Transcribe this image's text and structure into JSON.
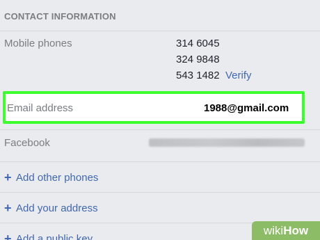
{
  "contact": {
    "section_title": "CONTACT INFORMATION",
    "mobile_label": "Mobile phones",
    "phones": [
      "314 6045",
      "324 9848",
      "543 1482"
    ],
    "verify_label": "Verify",
    "email_label": "Email address",
    "email_value": "1988@gmail.com",
    "facebook_label": "Facebook",
    "add_links": [
      "Add other phones",
      "Add your address",
      "Add a public key"
    ]
  },
  "icons": {
    "plus": "+"
  },
  "watermark": {
    "wiki": "wiki",
    "how": "How"
  },
  "colors": {
    "background": "#e9ebee",
    "link": "#4267b2",
    "highlight_border": "#3cff2d",
    "label_gray": "#7a7d82",
    "watermark_bg": "#8cbd66"
  }
}
